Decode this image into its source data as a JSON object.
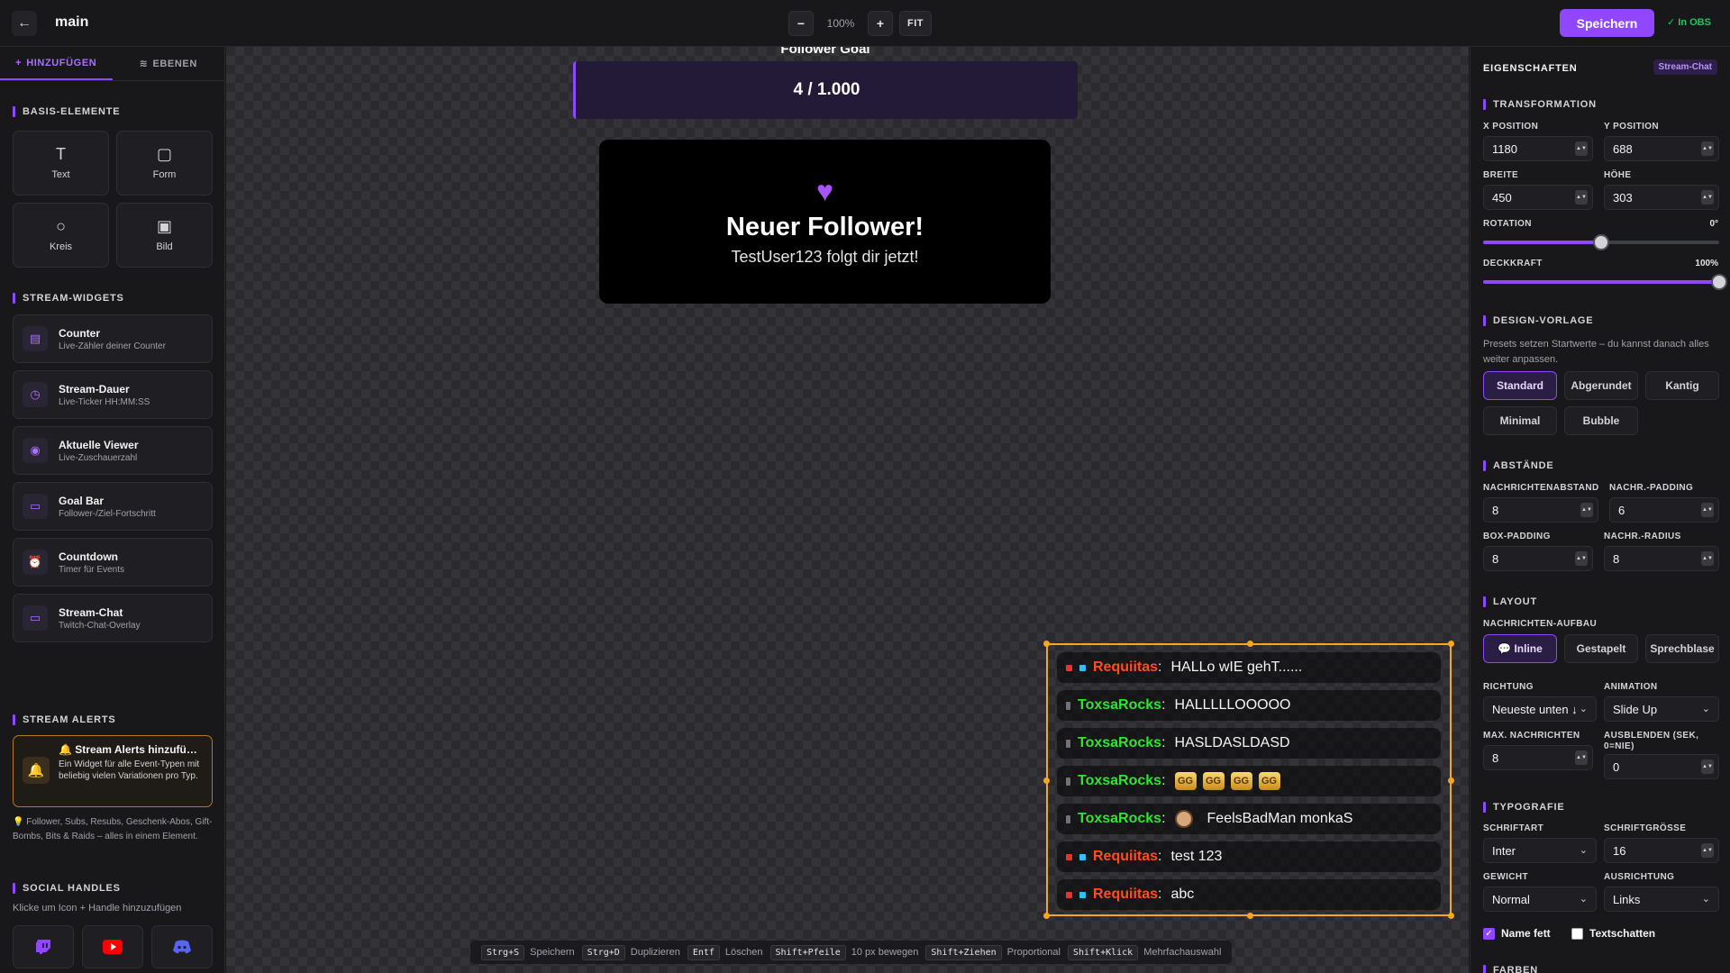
{
  "topbar": {
    "title": "main",
    "zoom_minus": "−",
    "zoom_value": "100%",
    "zoom_plus": "+",
    "fit": "FIT",
    "save": "Speichern",
    "obs_status": "✓ In OBS"
  },
  "sidebar": {
    "tabs": [
      {
        "label": "HINZUFÜGEN",
        "icon": "plus-icon",
        "active": true
      },
      {
        "label": "EBENEN",
        "icon": "layers-icon",
        "active": false
      }
    ],
    "basis_title": "BASIS-ELEMENTE",
    "basis": [
      {
        "label": "Text",
        "icon": "text-icon"
      },
      {
        "label": "Form",
        "icon": "square-icon"
      },
      {
        "label": "Kreis",
        "icon": "circle-icon"
      },
      {
        "label": "Bild",
        "icon": "image-icon"
      }
    ],
    "widgets_title": "STREAM-WIDGETS",
    "widgets": [
      {
        "title": "Counter",
        "sub": "Live-Zähler deiner Counter",
        "icon": "counter-icon"
      },
      {
        "title": "Stream-Dauer",
        "sub": "Live-Ticker HH:MM:SS",
        "icon": "stopwatch-icon"
      },
      {
        "title": "Aktuelle Viewer",
        "sub": "Live-Zuschauerzahl",
        "icon": "eye-icon"
      },
      {
        "title": "Goal Bar",
        "sub": "Follower-/Ziel-Fortschritt",
        "icon": "progress-icon"
      },
      {
        "title": "Countdown",
        "sub": "Timer für Events",
        "icon": "alarm-icon"
      },
      {
        "title": "Stream-Chat",
        "sub": "Twitch-Chat-Overlay",
        "icon": "chat-icon"
      }
    ],
    "alerts_title": "STREAM ALERTS",
    "alert_card_title": "🔔 Stream Alerts hinzufügen",
    "alert_card_desc": "Ein Widget für alle Event-Typen mit beliebig vielen Variationen pro Typ.",
    "alert_hint": "💡 Follower, Subs, Resubs, Geschenk-Abos, Gift-Bombs, Bits & Raids – alles in einem Element.",
    "social_title": "SOCIAL HANDLES",
    "social_sub": "Klicke um Icon + Handle hinzuzufügen",
    "socials": [
      "twitch-icon",
      "youtube-icon",
      "discord-icon",
      "instagram-icon",
      "tiktok-icon"
    ]
  },
  "canvas": {
    "goal_label": "Follower Goal",
    "goal_value": "4 / 1.000",
    "alert_heading": "Neuer Follower!",
    "alert_user": "TestUser123 folgt dir jetzt!",
    "chat": [
      {
        "name": "Requiitas",
        "color": "#ff4d1f",
        "badges": [
          "red",
          "blue"
        ],
        "msg": "HALLo wIE gehT......"
      },
      {
        "name": "ToxsaRocks",
        "color": "#2ee52e",
        "badges": [
          "gray"
        ],
        "msg": "HALLLLLOOOOO"
      },
      {
        "name": "ToxsaRocks",
        "color": "#2ee52e",
        "badges": [
          "gray"
        ],
        "msg": "HASLDASLDASD"
      },
      {
        "name": "ToxsaRocks",
        "color": "#2ee52e",
        "badges": [
          "gray"
        ],
        "msg": "",
        "emotes": [
          "GG",
          "GG",
          "GG",
          "GG"
        ]
      },
      {
        "name": "ToxsaRocks",
        "color": "#2ee52e",
        "badges": [
          "gray"
        ],
        "msg": "FeelsBadMan monkaS",
        "face": true
      },
      {
        "name": "Requiitas",
        "color": "#ff4d1f",
        "badges": [
          "red",
          "blue"
        ],
        "msg": "test 123"
      },
      {
        "name": "Requiitas",
        "color": "#ff4d1f",
        "badges": [
          "red",
          "blue"
        ],
        "msg": "abc"
      }
    ],
    "shortcuts": [
      {
        "key": "Strg+S",
        "label": "Speichern"
      },
      {
        "key": "Strg+D",
        "label": "Duplizieren"
      },
      {
        "key": "Entf",
        "label": "Löschen"
      },
      {
        "key": "Shift+Pfeile",
        "label": "10 px bewegen"
      },
      {
        "key": "Shift+Ziehen",
        "label": "Proportional"
      },
      {
        "key": "Shift+Klick",
        "label": "Mehrfachauswahl"
      }
    ]
  },
  "props": {
    "title": "EIGENSCHAFTEN",
    "badge": "Stream-Chat",
    "transform_title": "TRANSFORMATION",
    "x_label": "X POSITION",
    "x_value": "1180",
    "y_label": "Y POSITION",
    "y_value": "688",
    "w_label": "BREITE",
    "w_value": "450",
    "h_label": "HÖHE",
    "h_value": "303",
    "rotation_label": "ROTATION",
    "rotation_value": "0°",
    "rotation_level": 0.5,
    "opacity_label": "DECKKRAFT",
    "opacity_value": "100%",
    "opacity_level": 1.0,
    "design_title": "DESIGN-VORLAGE",
    "design_desc": "Presets setzen Startwerte – du kannst danach alles weiter anpassen.",
    "presets": [
      "Standard",
      "Abgerundet",
      "Kantig",
      "Minimal",
      "Bubble"
    ],
    "preset_selected": "Standard",
    "spacing_title": "ABSTÄNDE",
    "msg_gap_label": "NACHRICHTENABSTAND",
    "msg_gap_value": "8",
    "msg_pad_label": "NACHR.-PADDING",
    "msg_pad_value": "6",
    "box_pad_label": "BOX-PADDING",
    "box_pad_value": "8",
    "msg_radius_label": "NACHR.-RADIUS",
    "msg_radius_value": "8",
    "layout_title": "LAYOUT",
    "msg_layout_label": "NACHRICHTEN-AUFBAU",
    "layouts": [
      "💬 Inline",
      "Gestapelt",
      "Sprechblase"
    ],
    "direction_label": "RICHTUNG",
    "direction_value": "Neueste unten ↓",
    "animation_label": "ANIMATION",
    "animation_value": "Slide Up",
    "max_msgs_label": "MAX. NACHRICHTEN",
    "max_msgs_value": "8",
    "hide_label": "AUSBLENDEN (SEK, 0=NIE)",
    "hide_value": "0",
    "typo_title": "TYPOGRAFIE",
    "font_label": "SCHRIFTART",
    "font_value": "Inter",
    "size_label": "SCHRIFTGRÖSSE",
    "size_value": "16",
    "weight_label": "GEWICHT",
    "weight_value": "Normal",
    "align_label": "AUSRICHTUNG",
    "align_value": "Links",
    "name_bold_label": "Name fett",
    "name_bold": true,
    "shadow_label": "Textschatten",
    "shadow": false,
    "colors_title": "FARBEN"
  },
  "colors": {
    "accent": "#9146ff",
    "selection": "#f5a623",
    "obs": "#22c55e"
  }
}
